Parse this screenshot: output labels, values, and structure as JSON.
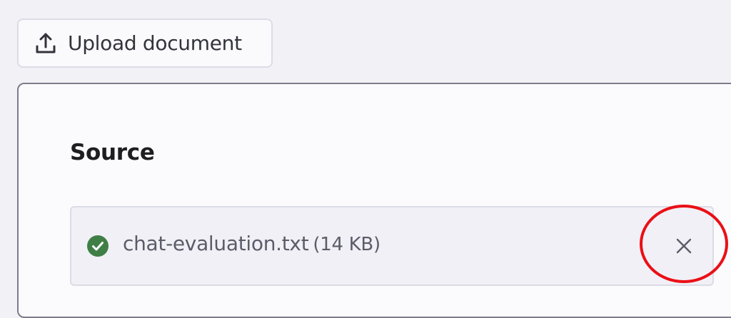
{
  "toolbar": {
    "upload_label": "Upload document",
    "upload_icon": "upload-icon"
  },
  "source": {
    "title": "Source",
    "file": {
      "name": "chat-evaluation.txt",
      "size": "(14 KB)",
      "status_icon": "check-circle-icon",
      "status_color": "#3f7f46",
      "remove_icon": "close-icon"
    }
  },
  "annotation": {
    "highlight_color": "#ea0f16"
  }
}
